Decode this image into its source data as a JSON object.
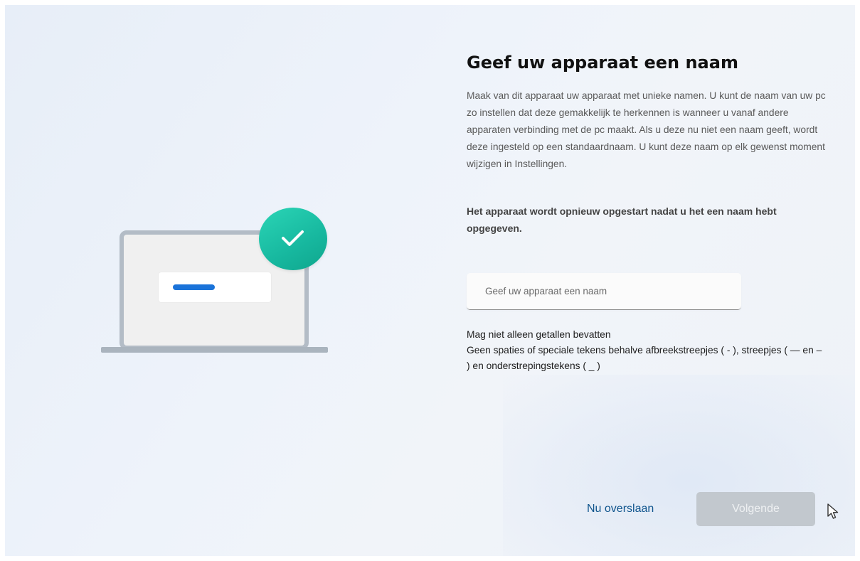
{
  "heading": "Geef uw apparaat een naam",
  "description": "Maak van dit apparaat uw apparaat met unieke namen. U kunt de naam van uw pc zo instellen dat deze gemakkelijk te herkennen is wanneer u vanaf andere apparaten verbinding met de pc maakt. Als u deze nu niet een naam geeft, wordt deze ingesteld op een standaardnaam. U kunt deze naam op elk gewenst moment wijzigen in Instellingen.",
  "restart_note": "Het apparaat wordt opnieuw opgestart nadat u het een naam hebt opgegeven.",
  "name_input": {
    "placeholder": "Geef uw apparaat een naam",
    "value": ""
  },
  "rules": [
    "Mag niet alleen getallen bevatten",
    "Geen spaties of speciale tekens behalve afbreekstreepjes ( - ), streepjes ( — en – ) en onderstrepingstekens ( _ )"
  ],
  "actions": {
    "skip_label": "Nu overslaan",
    "next_label": "Volgende",
    "next_enabled": false
  },
  "colors": {
    "accent": "#1a73d9",
    "check_badge": "#19bfa3",
    "link": "#10558d",
    "disabled_button": "#c2c8ce"
  },
  "icons": {
    "badge": "checkmark-icon",
    "pointer": "mouse-cursor-icon"
  }
}
